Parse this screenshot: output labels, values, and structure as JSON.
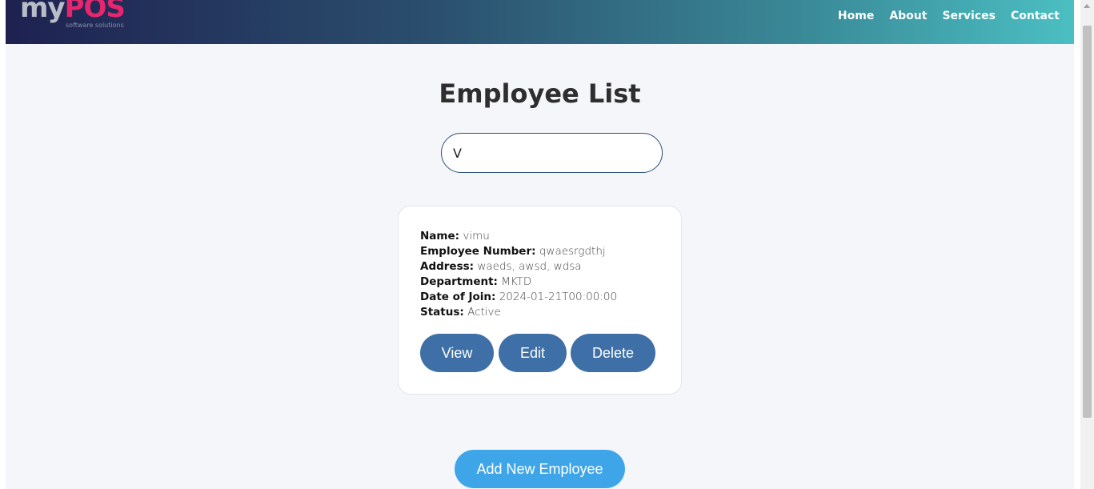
{
  "header": {
    "logo_my": "my",
    "logo_pos": "POS",
    "logo_sub": "software solutions",
    "nav": [
      "Home",
      "About",
      "Services",
      "Contact"
    ]
  },
  "page": {
    "title": "Employee List"
  },
  "search": {
    "value": "V"
  },
  "employee": {
    "fields": [
      {
        "label": "Name:",
        "value": "vimu"
      },
      {
        "label": "Employee Number:",
        "value": "qwaesrgdthj"
      },
      {
        "label": "Address:",
        "value": "waeds, awsd, wdsa"
      },
      {
        "label": "Department:",
        "value": "MKTD"
      },
      {
        "label": "Date of Join:",
        "value": "2024-01-21T00:00:00"
      },
      {
        "label": "Status:",
        "value": "Active"
      }
    ],
    "buttons": {
      "view": "View",
      "edit": "Edit",
      "delete": "Delete"
    }
  },
  "add_button": "Add New Employee",
  "colors": {
    "header_start": "#1e2150",
    "header_end": "#4bbfc2",
    "button": "#3e6fa6",
    "add_button": "#3ea6e8",
    "logo_accent": "#e8256d"
  }
}
